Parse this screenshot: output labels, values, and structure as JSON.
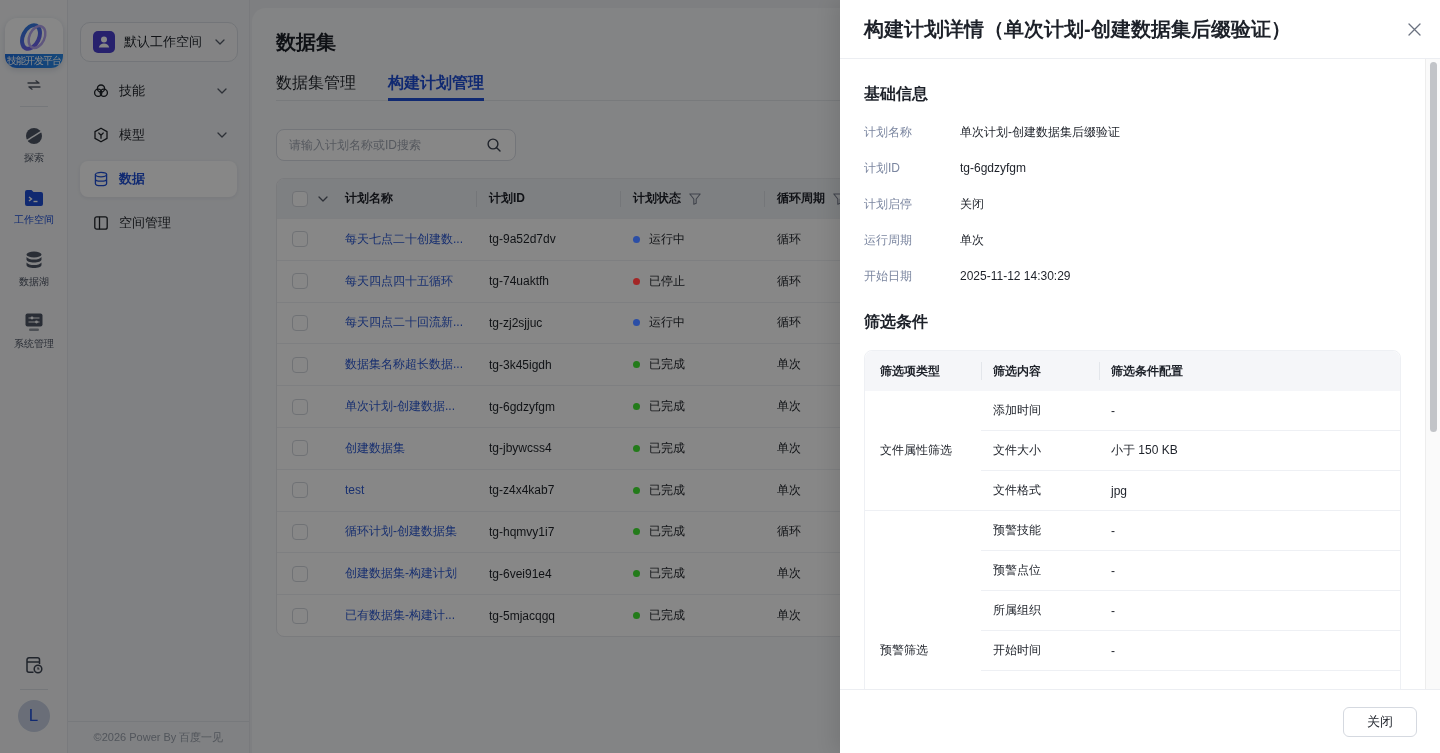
{
  "rail": {
    "logo_caption": "技能开发平台",
    "items": [
      {
        "label": "探索",
        "selected": false
      },
      {
        "label": "工作空间",
        "selected": true
      },
      {
        "label": "数据湖",
        "selected": false
      },
      {
        "label": "系统管理",
        "selected": false
      }
    ],
    "avatar": "L"
  },
  "sidebar": {
    "workspace": "默认工作空间",
    "items": [
      {
        "label": "技能",
        "kind": "group",
        "expanded": false,
        "selected": false
      },
      {
        "label": "模型",
        "kind": "group",
        "expanded": false,
        "selected": false
      },
      {
        "label": "数据",
        "kind": "page",
        "selected": true
      },
      {
        "label": "空间管理",
        "kind": "page",
        "selected": false
      }
    ],
    "footer": "©2026 Power By 百度一见"
  },
  "page": {
    "title": "数据集",
    "tabs": [
      {
        "label": "数据集管理",
        "selected": false
      },
      {
        "label": "构建计划管理",
        "selected": true
      }
    ],
    "search": {
      "placeholder": "请输入计划名称或ID搜索"
    },
    "table": {
      "select_all": {
        "checked": false
      },
      "columns": [
        {
          "label": "计划名称",
          "filterable": false
        },
        {
          "label": "计划ID",
          "filterable": false
        },
        {
          "label": "计划状态",
          "filterable": true
        },
        {
          "label": "循环周期",
          "filterable": true
        }
      ],
      "rows": [
        {
          "checked": false,
          "name": "每天七点二十创建数...",
          "plan_id": "tg-9a52d7dv",
          "status": "运行中",
          "color": "#2b4ea6",
          "cycle": "循环"
        },
        {
          "checked": false,
          "name": "每天四点四十五循环",
          "plan_id": "tg-74uaktfh",
          "status": "已停止",
          "color": "#a32626",
          "cycle": "循环"
        },
        {
          "checked": false,
          "name": "每天四点二十回流新...",
          "plan_id": "tg-zj2sjjuc",
          "status": "运行中",
          "color": "#2b4ea6",
          "cycle": "循环"
        },
        {
          "checked": false,
          "name": "数据集名称超长数据...",
          "plan_id": "tg-3k45igdh",
          "status": "已完成",
          "color": "#237b1a",
          "cycle": "单次"
        },
        {
          "checked": false,
          "name": "单次计划-创建数据...",
          "plan_id": "tg-6gdzyfgm",
          "status": "已完成",
          "color": "#237b1a",
          "cycle": "单次"
        },
        {
          "checked": false,
          "name": "创建数据集",
          "plan_id": "tg-jbywcss4",
          "status": "已完成",
          "color": "#237b1a",
          "cycle": "单次"
        },
        {
          "checked": false,
          "name": "test",
          "plan_id": "tg-z4x4kab7",
          "status": "已完成",
          "color": "#237b1a",
          "cycle": "单次"
        },
        {
          "checked": false,
          "name": "循环计划-创建数据集",
          "plan_id": "tg-hqmvy1i7",
          "status": "已完成",
          "color": "#237b1a",
          "cycle": "循环"
        },
        {
          "checked": false,
          "name": "创建数据集-构建计划",
          "plan_id": "tg-6vei91e4",
          "status": "已完成",
          "color": "#237b1a",
          "cycle": "单次"
        },
        {
          "checked": false,
          "name": "已有数据集-构建计...",
          "plan_id": "tg-5mjacqgq",
          "status": "已完成",
          "color": "#237b1a",
          "cycle": "单次"
        }
      ]
    }
  },
  "drawer": {
    "title": "构建计划详情（单次计划-创建数据集后缀验证）",
    "basic": {
      "title": "基础信息",
      "fields": [
        {
          "label": "计划名称",
          "value": "单次计划-创建数据集后缀验证"
        },
        {
          "label": "计划ID",
          "value": "tg-6gdzyfgm"
        },
        {
          "label": "计划启停",
          "value": "关闭"
        },
        {
          "label": "运行周期",
          "value": "单次"
        },
        {
          "label": "开始日期",
          "value": "2025-11-12 14:30:29"
        }
      ]
    },
    "filters": {
      "title": "筛选条件",
      "columns": [
        "筛选项类型",
        "筛选内容",
        "筛选条件配置"
      ],
      "groups": [
        {
          "type": "文件属性筛选",
          "items": [
            {
              "content": "添加时间",
              "config": "-"
            },
            {
              "content": "文件大小",
              "config": "小于 150 KB"
            },
            {
              "content": "文件格式",
              "config": "jpg"
            }
          ]
        },
        {
          "type": "预警筛选",
          "items": [
            {
              "content": "预警技能",
              "config": "-"
            },
            {
              "content": "预警点位",
              "config": "-"
            },
            {
              "content": "所属组织",
              "config": "-"
            },
            {
              "content": "开始时间",
              "config": "-"
            }
          ]
        }
      ]
    },
    "buttons": [
      "关闭"
    ]
  }
}
